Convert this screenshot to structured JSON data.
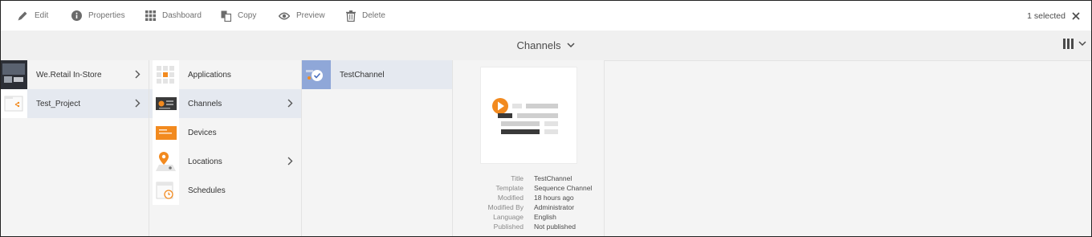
{
  "toolbar": {
    "edit": "Edit",
    "properties": "Properties",
    "dashboard": "Dashboard",
    "copy": "Copy",
    "preview": "Preview",
    "delete": "Delete",
    "selection_count": "1 selected"
  },
  "header": {
    "title": "Channels"
  },
  "columns": {
    "projects": [
      {
        "label": "We.Retail In-Store"
      },
      {
        "label": "Test_Project"
      }
    ],
    "project_items": [
      {
        "label": "Applications"
      },
      {
        "label": "Channels"
      },
      {
        "label": "Devices"
      },
      {
        "label": "Locations"
      },
      {
        "label": "Schedules"
      }
    ],
    "channels": [
      {
        "label": "TestChannel"
      }
    ]
  },
  "preview": {
    "metadata": [
      {
        "key": "Title",
        "value": "TestChannel"
      },
      {
        "key": "Template",
        "value": "Sequence Channel"
      },
      {
        "key": "Modified",
        "value": "18 hours ago"
      },
      {
        "key": "Modified By",
        "value": "Administrator"
      },
      {
        "key": "Language",
        "value": "English"
      },
      {
        "key": "Published",
        "value": "Not published"
      }
    ]
  },
  "colors": {
    "accent_orange": "#f28a1f",
    "selected_row": "#e5e9f0",
    "channel_thumb_blue": "#8fa7d8"
  }
}
